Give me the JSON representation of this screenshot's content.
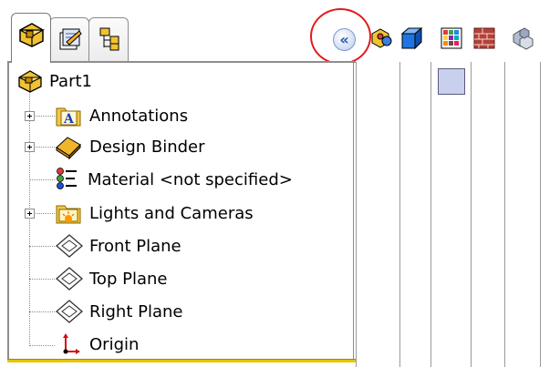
{
  "tree": {
    "root": {
      "label": "Part1",
      "icon": "part-icon"
    },
    "items": [
      {
        "label": "Annotations",
        "icon": "annotations-icon",
        "expandable": true
      },
      {
        "label": "Design Binder",
        "icon": "design-binder-icon",
        "expandable": true
      },
      {
        "label": "Material <not specified>",
        "icon": "material-icon",
        "expandable": false
      },
      {
        "label": "Lights and Cameras",
        "icon": "lights-cameras-icon",
        "expandable": true
      },
      {
        "label": "Front Plane",
        "icon": "plane-icon",
        "expandable": false
      },
      {
        "label": "Top Plane",
        "icon": "plane-icon",
        "expandable": false
      },
      {
        "label": "Right Plane",
        "icon": "plane-icon",
        "expandable": false
      },
      {
        "label": "Origin",
        "icon": "origin-icon",
        "expandable": false
      }
    ]
  },
  "tabs": [
    {
      "icon": "feature-manager-icon",
      "active": true
    },
    {
      "icon": "property-manager-icon",
      "active": false
    },
    {
      "icon": "configuration-manager-icon",
      "active": false
    }
  ],
  "toolbar": {
    "collapse_label": "«",
    "icons": [
      "appearances-icon",
      "blue-cube-icon",
      "color-grid-icon",
      "brick-texture-icon",
      "scene-icon"
    ]
  },
  "colors": {
    "highlight_circle": "#e21b1b",
    "tree_bottom_bar": "#e7c400",
    "swatch": "#c8d0ee"
  }
}
